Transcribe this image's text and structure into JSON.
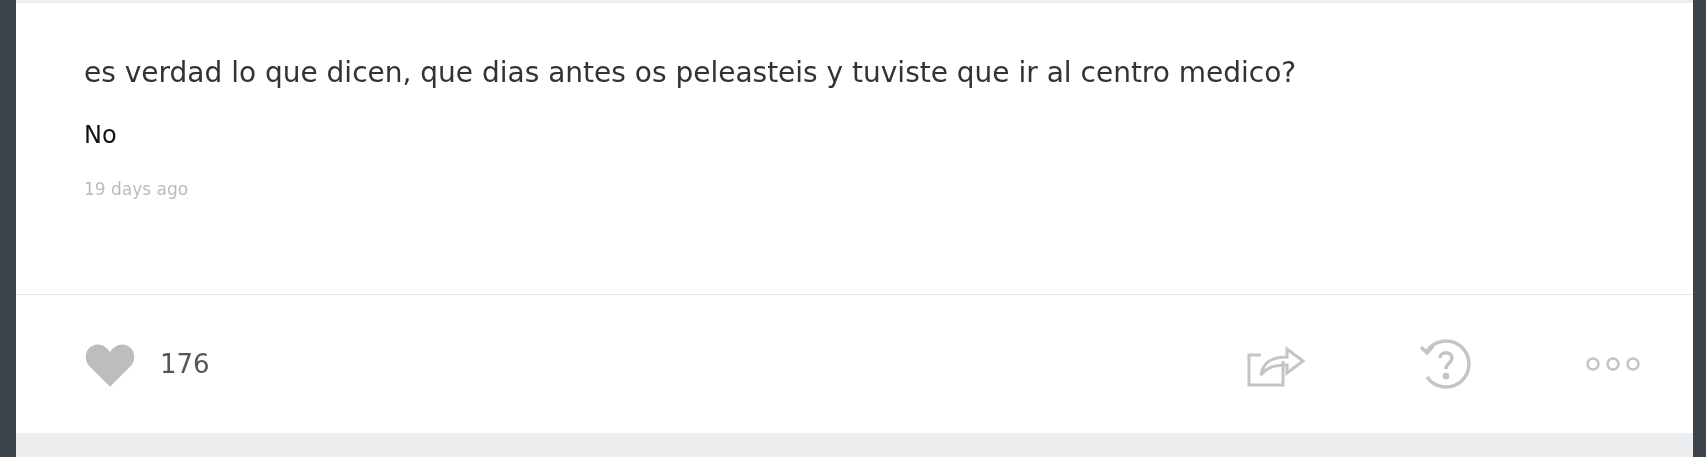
{
  "post": {
    "question": "es verdad lo que dicen, que dias antes os peleasteis y tuviste que ir al centro medico?",
    "answer": "No",
    "time": "19 days ago"
  },
  "footer": {
    "liked": false,
    "likes": "176"
  }
}
